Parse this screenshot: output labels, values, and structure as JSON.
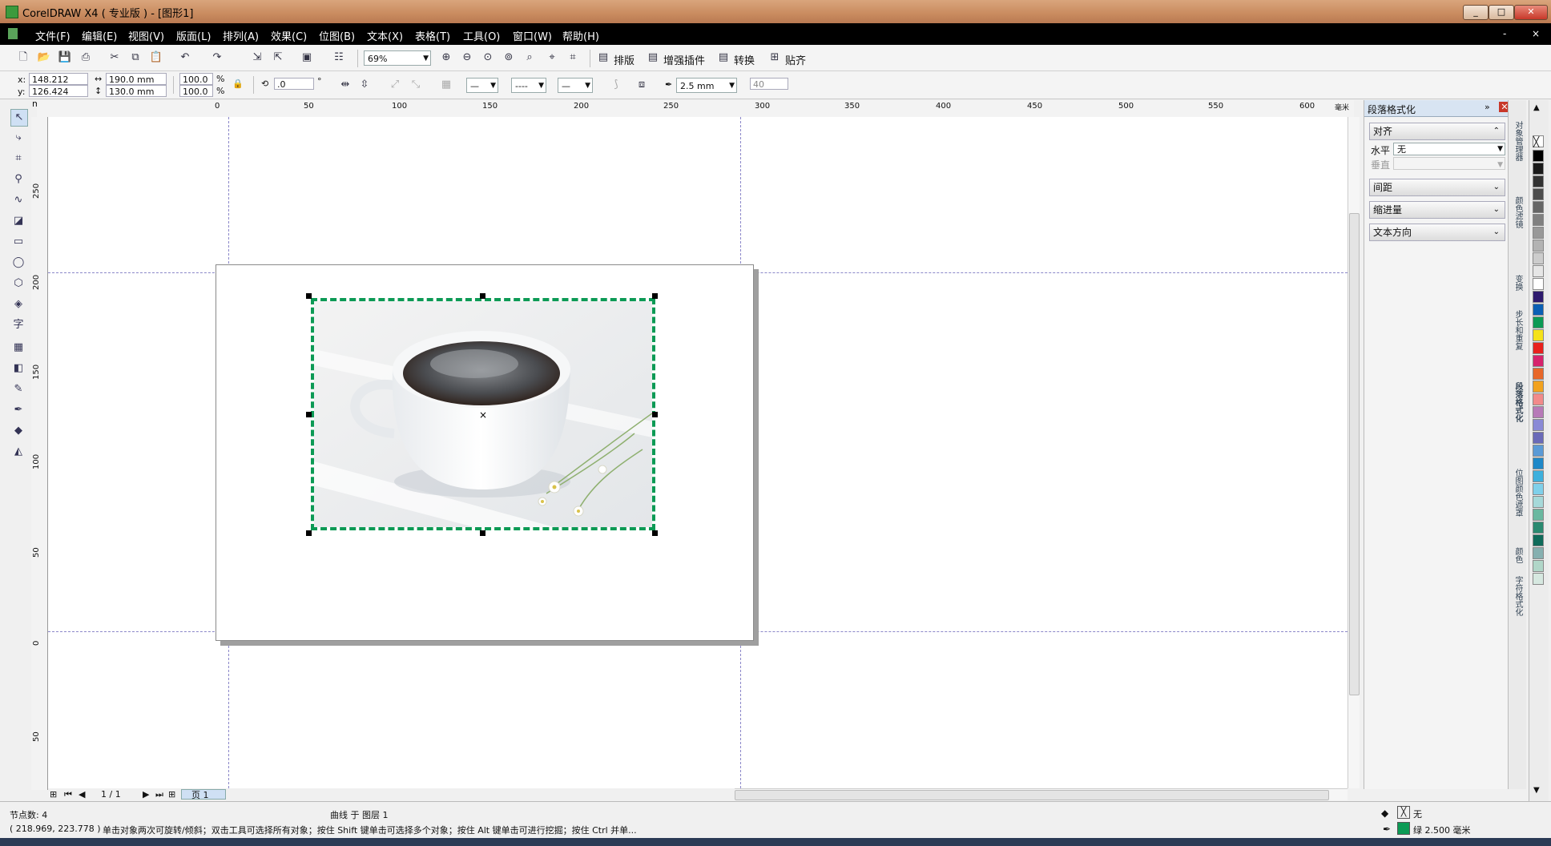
{
  "window": {
    "title": "CorelDRAW X4 ( 专业版 ) - [图形1]",
    "minimize": "_",
    "maximize": "□",
    "close": "✕"
  },
  "menu": [
    "文件(F)",
    "编辑(E)",
    "视图(V)",
    "版面(L)",
    "排列(A)",
    "效果(C)",
    "位图(B)",
    "文本(X)",
    "表格(T)",
    "工具(O)",
    "窗口(W)",
    "帮助(H)"
  ],
  "mdi_controls": [
    "-",
    "×"
  ],
  "toolbar": {
    "zoom": "69%",
    "buttons": [
      "排版",
      "增强插件",
      "转换",
      "贴齐"
    ]
  },
  "property_bar": {
    "x_label": "x:",
    "x": "148.212 mm",
    "y_label": "y:",
    "y": "126.424 mm",
    "w": "190.0 mm",
    "h": "130.0 mm",
    "scale_x": "100.0",
    "scale_y": "100.0",
    "pct": "%",
    "rotation": ".0",
    "deg": "°",
    "outline_width": "2.5 mm",
    "spin": "40"
  },
  "ruler": {
    "top": [
      "0",
      "50",
      "100",
      "150",
      "200",
      "250",
      "300",
      "350",
      "400",
      "450",
      "500",
      "550",
      "600"
    ],
    "top_unit": "毫米",
    "left": [
      "250",
      "200",
      "150",
      "100",
      "50",
      "0",
      "50"
    ]
  },
  "page_nav": {
    "counter": "1 / 1",
    "tab": "页 1"
  },
  "docker": {
    "title": "段落格式化",
    "sections": {
      "align": "对齐",
      "horizontal_label": "水平",
      "horizontal_value": "无",
      "vertical_label": "垂直",
      "spacing": "间距",
      "indent": "缩进量",
      "text_direction": "文本方向"
    }
  },
  "docker_tabs": [
    "对象管理器",
    "颜色滤镜",
    "变换",
    "步长和重复",
    "段落格式化",
    "位图颜色遮罩",
    "颜色",
    "字符格式化"
  ],
  "palette": [
    "#000000",
    "#1a1a1a",
    "#333333",
    "#4d4d4d",
    "#666666",
    "#808080",
    "#999999",
    "#b3b3b3",
    "#cccccc",
    "#e6e6e6",
    "#ffffff",
    "#2e1a6e",
    "#0a5fb4",
    "#0c9a55",
    "#f5e21a",
    "#e8211d",
    "#d6246d",
    "#e8682a",
    "#f2a21f",
    "#f28a8a",
    "#b77ab8",
    "#8a8ad6",
    "#6a6ab8",
    "#5a9ad6",
    "#1e88c8",
    "#3db0dd",
    "#7fd0ea",
    "#a6d9d9",
    "#6ab8a0",
    "#2a8a70",
    "#0f6b5a",
    "#86b0b0",
    "#b0d6c8",
    "#d6e8e0"
  ],
  "status": {
    "nodes": "节点数: 4",
    "object": "曲线 于 图层 1",
    "coords": "( 218.969, 223.778 )",
    "hint": "单击对象两次可旋转/倾斜；双击工具可选择所有对象；按住 Shift 键单击可选择多个对象；按住 Alt 键单击可进行挖掘；按住 Ctrl 并单...",
    "fill": "无",
    "outline": "绿  2.500 毫米"
  },
  "colors": {
    "selection": "#0c9a55",
    "guide": "#8b87c9"
  }
}
